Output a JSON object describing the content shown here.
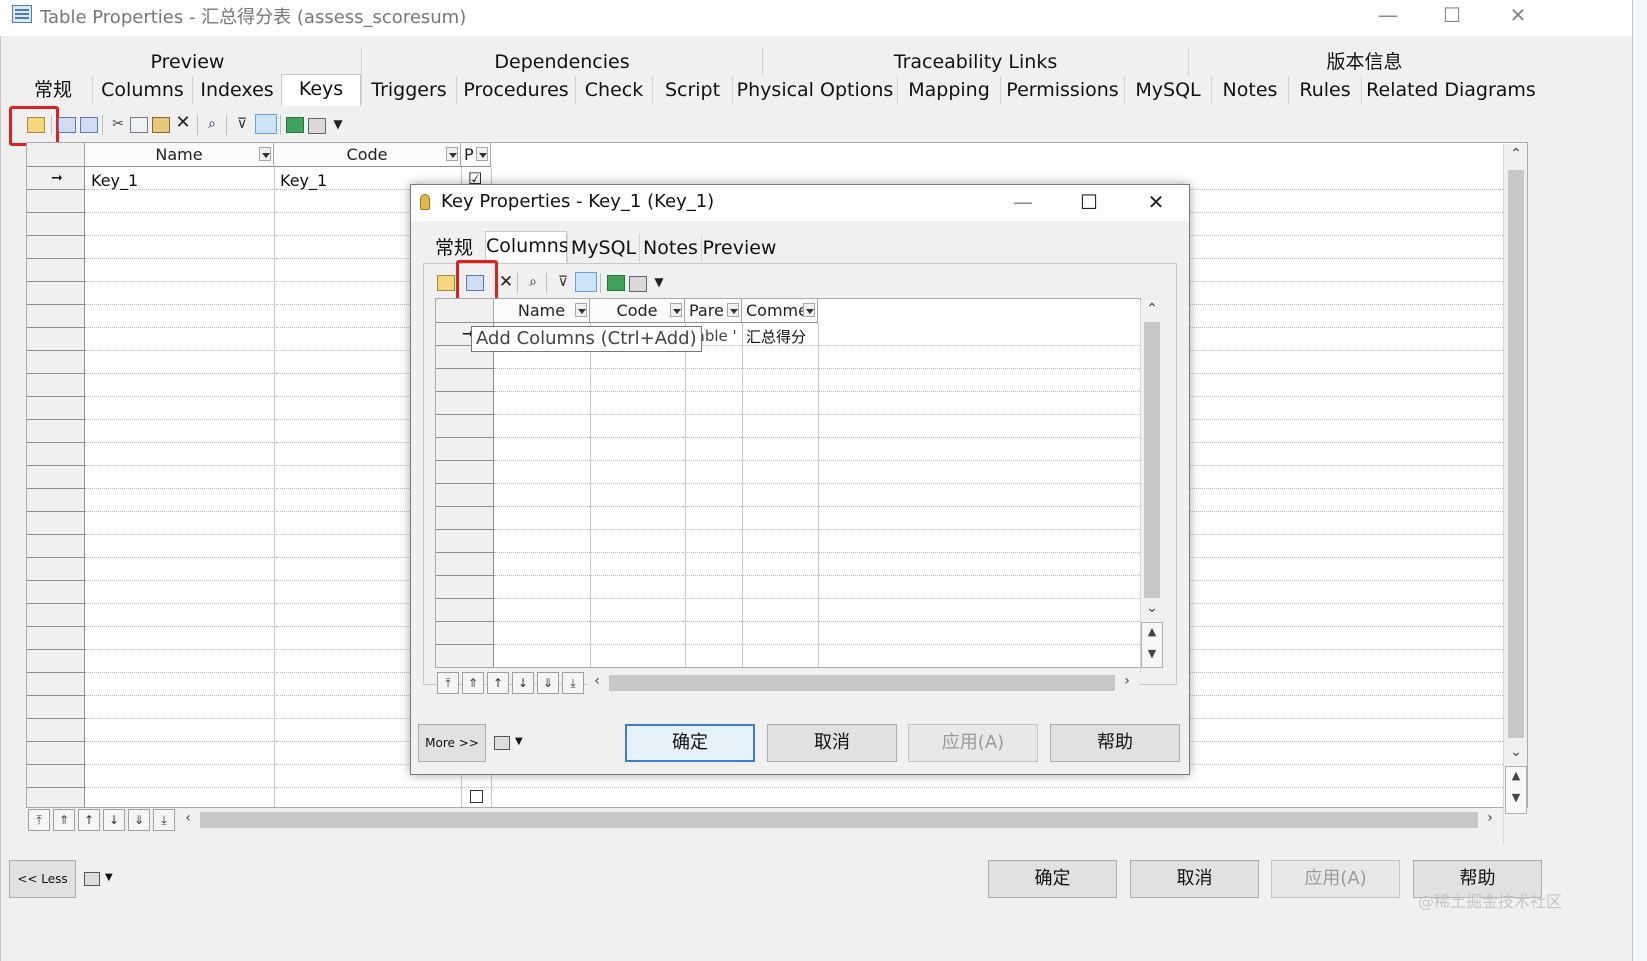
{
  "window": {
    "title": "Table Properties - 汇总得分表 (assess_scoresum)"
  },
  "tabs_row1": [
    "Preview",
    "Dependencies",
    "Traceability Links",
    "版本信息"
  ],
  "tabs_row2": [
    "常规",
    "Columns",
    "Indexes",
    "Keys",
    "Triggers",
    "Procedures",
    "Check",
    "Script",
    "Physical Options",
    "Mapping",
    "Permissions",
    "MySQL",
    "Notes",
    "Rules",
    "Related Diagrams"
  ],
  "active_tab": "Keys",
  "keys_grid": {
    "columns": [
      "Name",
      "Code",
      "P"
    ],
    "rows": [
      {
        "name": "Key_1",
        "code": "Key_1",
        "primary": "☑"
      }
    ]
  },
  "outer_buttons": {
    "less": "<< Less",
    "ok": "确定",
    "cancel": "取消",
    "apply": "应用(A)",
    "help": "帮助"
  },
  "dialog": {
    "title": "Key Properties - Key_1 (Key_1)",
    "tabs": [
      "常规",
      "Columns",
      "MySQL",
      "Notes",
      "Preview"
    ],
    "active_tab": "Columns",
    "grid": {
      "columns": [
        "Name",
        "Code",
        "Pare",
        "Comme"
      ],
      "rows": [
        {
          "parent": "Table '",
          "comment": "汇总得分"
        }
      ]
    },
    "tooltip": "Add Columns (Ctrl+Add)",
    "buttons": {
      "more": "More >>",
      "ok": "确定",
      "cancel": "取消",
      "apply": "应用(A)",
      "help": "帮助"
    }
  },
  "watermark": "@稀土掘金技术社区",
  "colors": {
    "highlight": "#e0201e",
    "default_button_border": "#3c7fd0"
  }
}
